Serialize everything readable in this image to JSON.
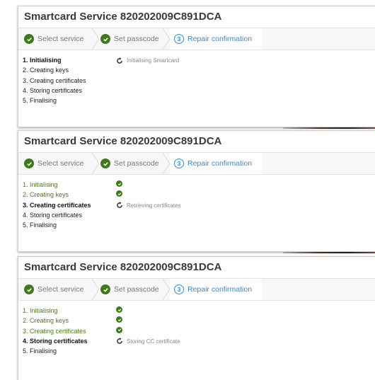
{
  "panels": [
    {
      "title": "Smartcard Service 820202009C891DCA",
      "wizard": [
        "Select service",
        "Set passcode",
        "Repair confirmation"
      ],
      "steps": [
        {
          "label": "1. Initialising",
          "state": "active",
          "status": "Initialising Smartcard"
        },
        {
          "label": "2. Creating keys",
          "state": "pending"
        },
        {
          "label": "3. Creating certificates",
          "state": "pending"
        },
        {
          "label": "4. Storing certificates",
          "state": "pending"
        },
        {
          "label": "5. Finalising",
          "state": "pending"
        }
      ]
    },
    {
      "title": "Smartcard Service 820202009C891DCA",
      "wizard": [
        "Select service",
        "Set passcode",
        "Repair confirmation"
      ],
      "steps": [
        {
          "label": "1. Initialising",
          "state": "complete"
        },
        {
          "label": "2. Creating keys",
          "state": "complete"
        },
        {
          "label": "3. Creating certificates",
          "state": "active",
          "status": "Retrieving certificates"
        },
        {
          "label": "4. Storing certificates",
          "state": "pending"
        },
        {
          "label": "5. Finalising",
          "state": "pending"
        }
      ]
    },
    {
      "title": "Smartcard Service 820202009C891DCA",
      "wizard": [
        "Select service",
        "Set passcode",
        "Repair confirmation"
      ],
      "steps": [
        {
          "label": "1. Initialising",
          "state": "complete"
        },
        {
          "label": "2. Creating keys",
          "state": "complete"
        },
        {
          "label": "3. Creating certificates",
          "state": "complete"
        },
        {
          "label": "4. Storing certificates",
          "state": "active",
          "status": "Storing CC certificate"
        },
        {
          "label": "5. Finalising",
          "state": "pending"
        }
      ]
    }
  ],
  "wizard_current_number": "3",
  "colors": {
    "complete": "#4f7a1c",
    "accent": "#2e8bd1"
  }
}
